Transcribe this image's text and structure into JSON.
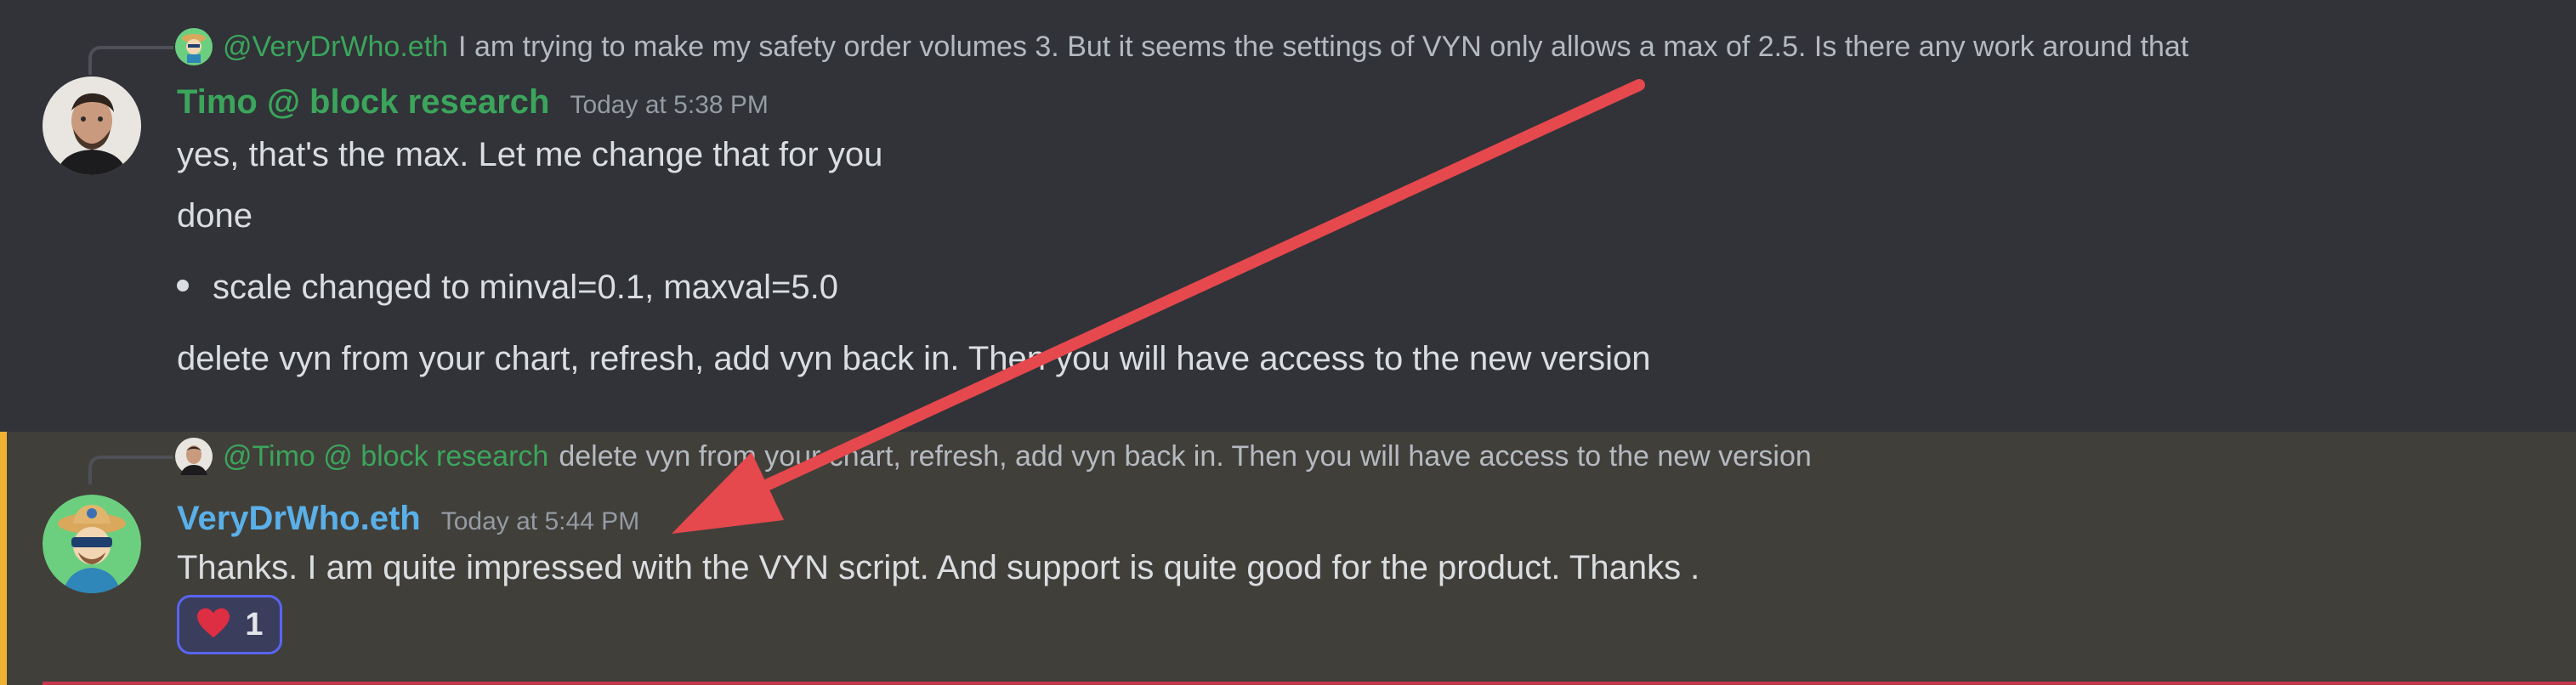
{
  "messages": [
    {
      "reply_to": {
        "mention": "@VeryDrWho.eth",
        "text": "I am trying to make my safety order volumes 3. But it seems the settings of VYN only allows a max of 2.5. Is there any work around that"
      },
      "author": "Timo @ block research",
      "timestamp": "Today at 5:38 PM",
      "lines": [
        "yes, that's the max. Let me change that for you",
        "done",
        "scale changed to minval=0.1, maxval=5.0",
        "delete vyn from your chart, refresh, add vyn back in. Then you will have access to the new version"
      ]
    },
    {
      "reply_to": {
        "mention": "@Timo @ block research",
        "text": "delete vyn from your chart, refresh, add vyn back in. Then you will have access to the new version"
      },
      "author": "VeryDrWho.eth",
      "timestamp": "Today at 5:44 PM",
      "lines": [
        "Thanks. I am quite impressed with the VYN script. And support is quite good for the product. Thanks ."
      ],
      "reaction": {
        "emoji": "heart-icon",
        "count": "1"
      }
    }
  ],
  "colors": {
    "background": "#313338",
    "highlight_background": "#413f3a",
    "highlight_accent": "#f0b232",
    "author_timo": "#3ba55c",
    "author_verydrwho": "#5ab0e8",
    "arrow": "#e5484d",
    "reaction_border": "#5865f2"
  },
  "annotation": {
    "type": "arrow",
    "icon": "arrow-annotation"
  }
}
